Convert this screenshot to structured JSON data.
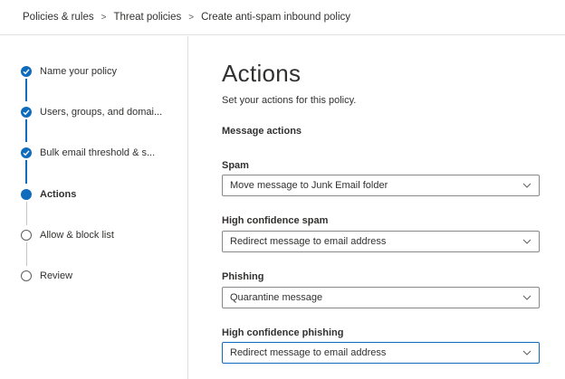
{
  "breadcrumb": {
    "items": [
      "Policies & rules",
      "Threat policies",
      "Create anti-spam inbound policy"
    ],
    "separator": ">"
  },
  "wizard": {
    "steps": [
      {
        "label": "Name your policy",
        "state": "done"
      },
      {
        "label": "Users, groups, and domai...",
        "state": "done"
      },
      {
        "label": "Bulk email threshold & s...",
        "state": "done"
      },
      {
        "label": "Actions",
        "state": "current"
      },
      {
        "label": "Allow & block list",
        "state": "todo"
      },
      {
        "label": "Review",
        "state": "todo"
      }
    ]
  },
  "main": {
    "title": "Actions",
    "subtitle": "Set your actions for this policy.",
    "section_heading": "Message actions",
    "fields": [
      {
        "label": "Spam",
        "value": "Move message to Junk Email folder"
      },
      {
        "label": "High confidence spam",
        "value": "Redirect message to email address"
      },
      {
        "label": "Phishing",
        "value": "Quarantine message"
      },
      {
        "label": "High confidence phishing",
        "value": "Redirect message to email address"
      }
    ]
  },
  "colors": {
    "accent": "#0f6cbd",
    "border": "#8a8886",
    "divider": "#e1dfdd",
    "text": "#323130"
  },
  "icons": {
    "step_done": "checkmark-icon",
    "dropdown": "chevron-down-icon",
    "breadcrumb_separator": "chevron-right-icon"
  }
}
